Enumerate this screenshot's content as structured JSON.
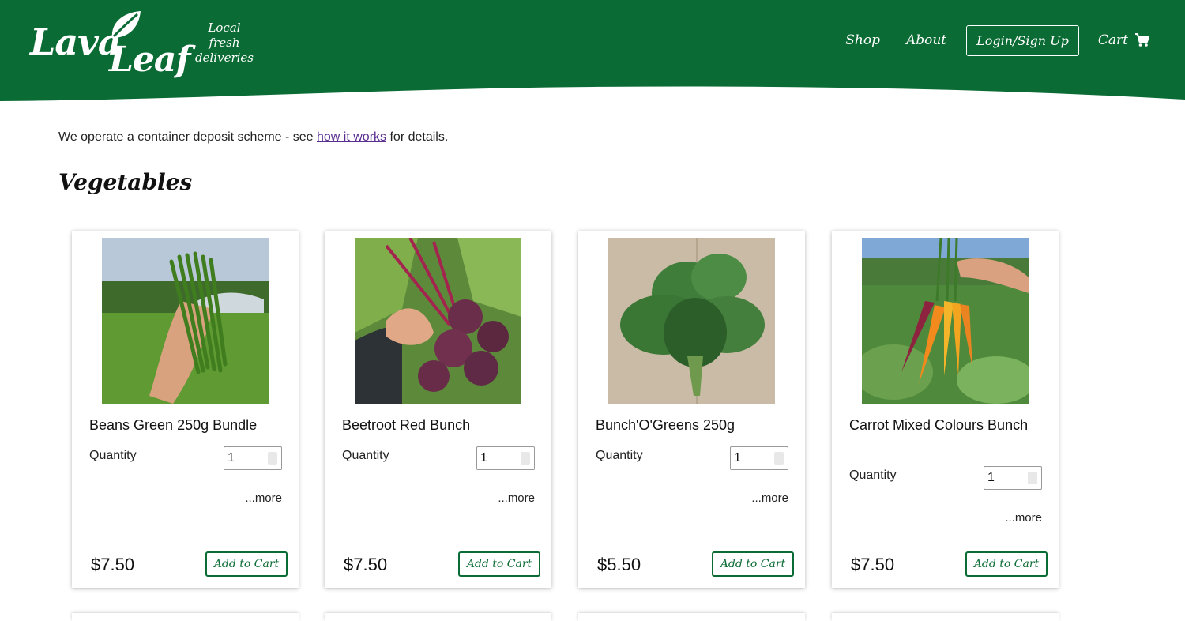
{
  "brand": {
    "logo_word_1": "Lava",
    "logo_word_2": "Leaf",
    "tagline_lines": [
      "Local",
      "fresh",
      "deliveries"
    ],
    "color_primary": "#0b6b34"
  },
  "nav": {
    "shop": "Shop",
    "about": "About",
    "login": "Login/Sign Up",
    "cart": "Cart",
    "cart_icon": "shopping-cart-icon"
  },
  "notice": {
    "prefix": "We operate a container deposit scheme - see ",
    "link": "how it works",
    "suffix": " for details."
  },
  "section": {
    "title": "Vegetables"
  },
  "products": [
    {
      "name": "Beans Green 250g Bundle",
      "quantity_label": "Quantity",
      "quantity": "1",
      "more": "...more",
      "price": "$7.50",
      "button": "Add to Cart"
    },
    {
      "name": "Beetroot Red Bunch",
      "quantity_label": "Quantity",
      "quantity": "1",
      "more": "...more",
      "price": "$7.50",
      "button": "Add to Cart"
    },
    {
      "name": "Bunch'O'Greens 250g",
      "quantity_label": "Quantity",
      "quantity": "1",
      "more": "...more",
      "price": "$5.50",
      "button": "Add to Cart"
    },
    {
      "name": "Carrot Mixed Colours Bunch",
      "quantity_label": "Quantity",
      "quantity": "1",
      "more": "...more",
      "price": "$7.50",
      "button": "Add to Cart"
    }
  ]
}
